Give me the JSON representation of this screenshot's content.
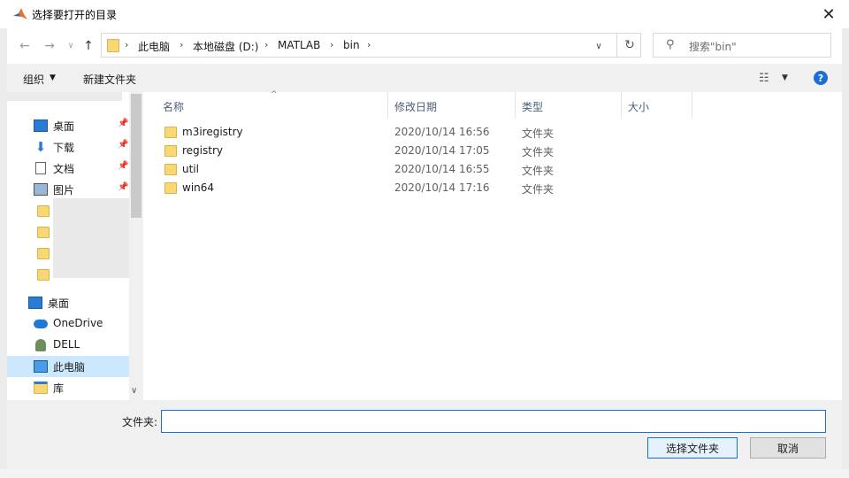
{
  "window": {
    "title": "选择要打开的目录",
    "close_glyph": "✕"
  },
  "nav": {
    "back_glyph": "←",
    "forward_glyph": "→",
    "recent_glyph": "∨",
    "up_glyph": "↑",
    "breadcrumbs": [
      "此电脑",
      "本地磁盘 (D:)",
      "MATLAB",
      "bin"
    ],
    "crumb_sep": "›",
    "dropdown_glyph": "∨",
    "refresh_glyph": "↻",
    "search_placeholder": "搜索\"bin\"",
    "search_glyph": "⚲"
  },
  "toolbar": {
    "organize": "组织",
    "caret": "▼",
    "new_folder": "新建文件夹",
    "view_glyph": "☷",
    "help": "?"
  },
  "sidebar": {
    "pinned": [
      {
        "label": "桌面",
        "icon": "desktop-icon"
      },
      {
        "label": "下载",
        "icon": "download-icon"
      },
      {
        "label": "文档",
        "icon": "document-icon"
      },
      {
        "label": "图片",
        "icon": "picture-icon"
      }
    ],
    "pin_glyph": "📌",
    "locations": [
      {
        "label": "桌面",
        "icon": "desktop-icon"
      },
      {
        "label": "OneDrive",
        "icon": "onedrive-icon"
      },
      {
        "label": "DELL",
        "icon": "user-icon"
      },
      {
        "label": "此电脑",
        "icon": "computer-icon"
      },
      {
        "label": "库",
        "icon": "library-icon"
      }
    ],
    "scroll_down_glyph": "∨"
  },
  "columns": {
    "name": "名称",
    "modified": "修改日期",
    "type": "类型",
    "size": "大小",
    "sort_glyph": "^"
  },
  "files": [
    {
      "name": "m3iregistry",
      "modified": "2020/10/14 16:56",
      "type": "文件夹"
    },
    {
      "name": "registry",
      "modified": "2020/10/14 17:05",
      "type": "文件夹"
    },
    {
      "name": "util",
      "modified": "2020/10/14 16:55",
      "type": "文件夹"
    },
    {
      "name": "win64",
      "modified": "2020/10/14 17:16",
      "type": "文件夹"
    }
  ],
  "bottom": {
    "folder_label": "文件夹:",
    "folder_value": "",
    "select_button": "选择文件夹",
    "cancel_button": "取消"
  },
  "colors": {
    "accent": "#1a6fd6",
    "folder": "#f8d775",
    "selected": "#cce8ff"
  }
}
